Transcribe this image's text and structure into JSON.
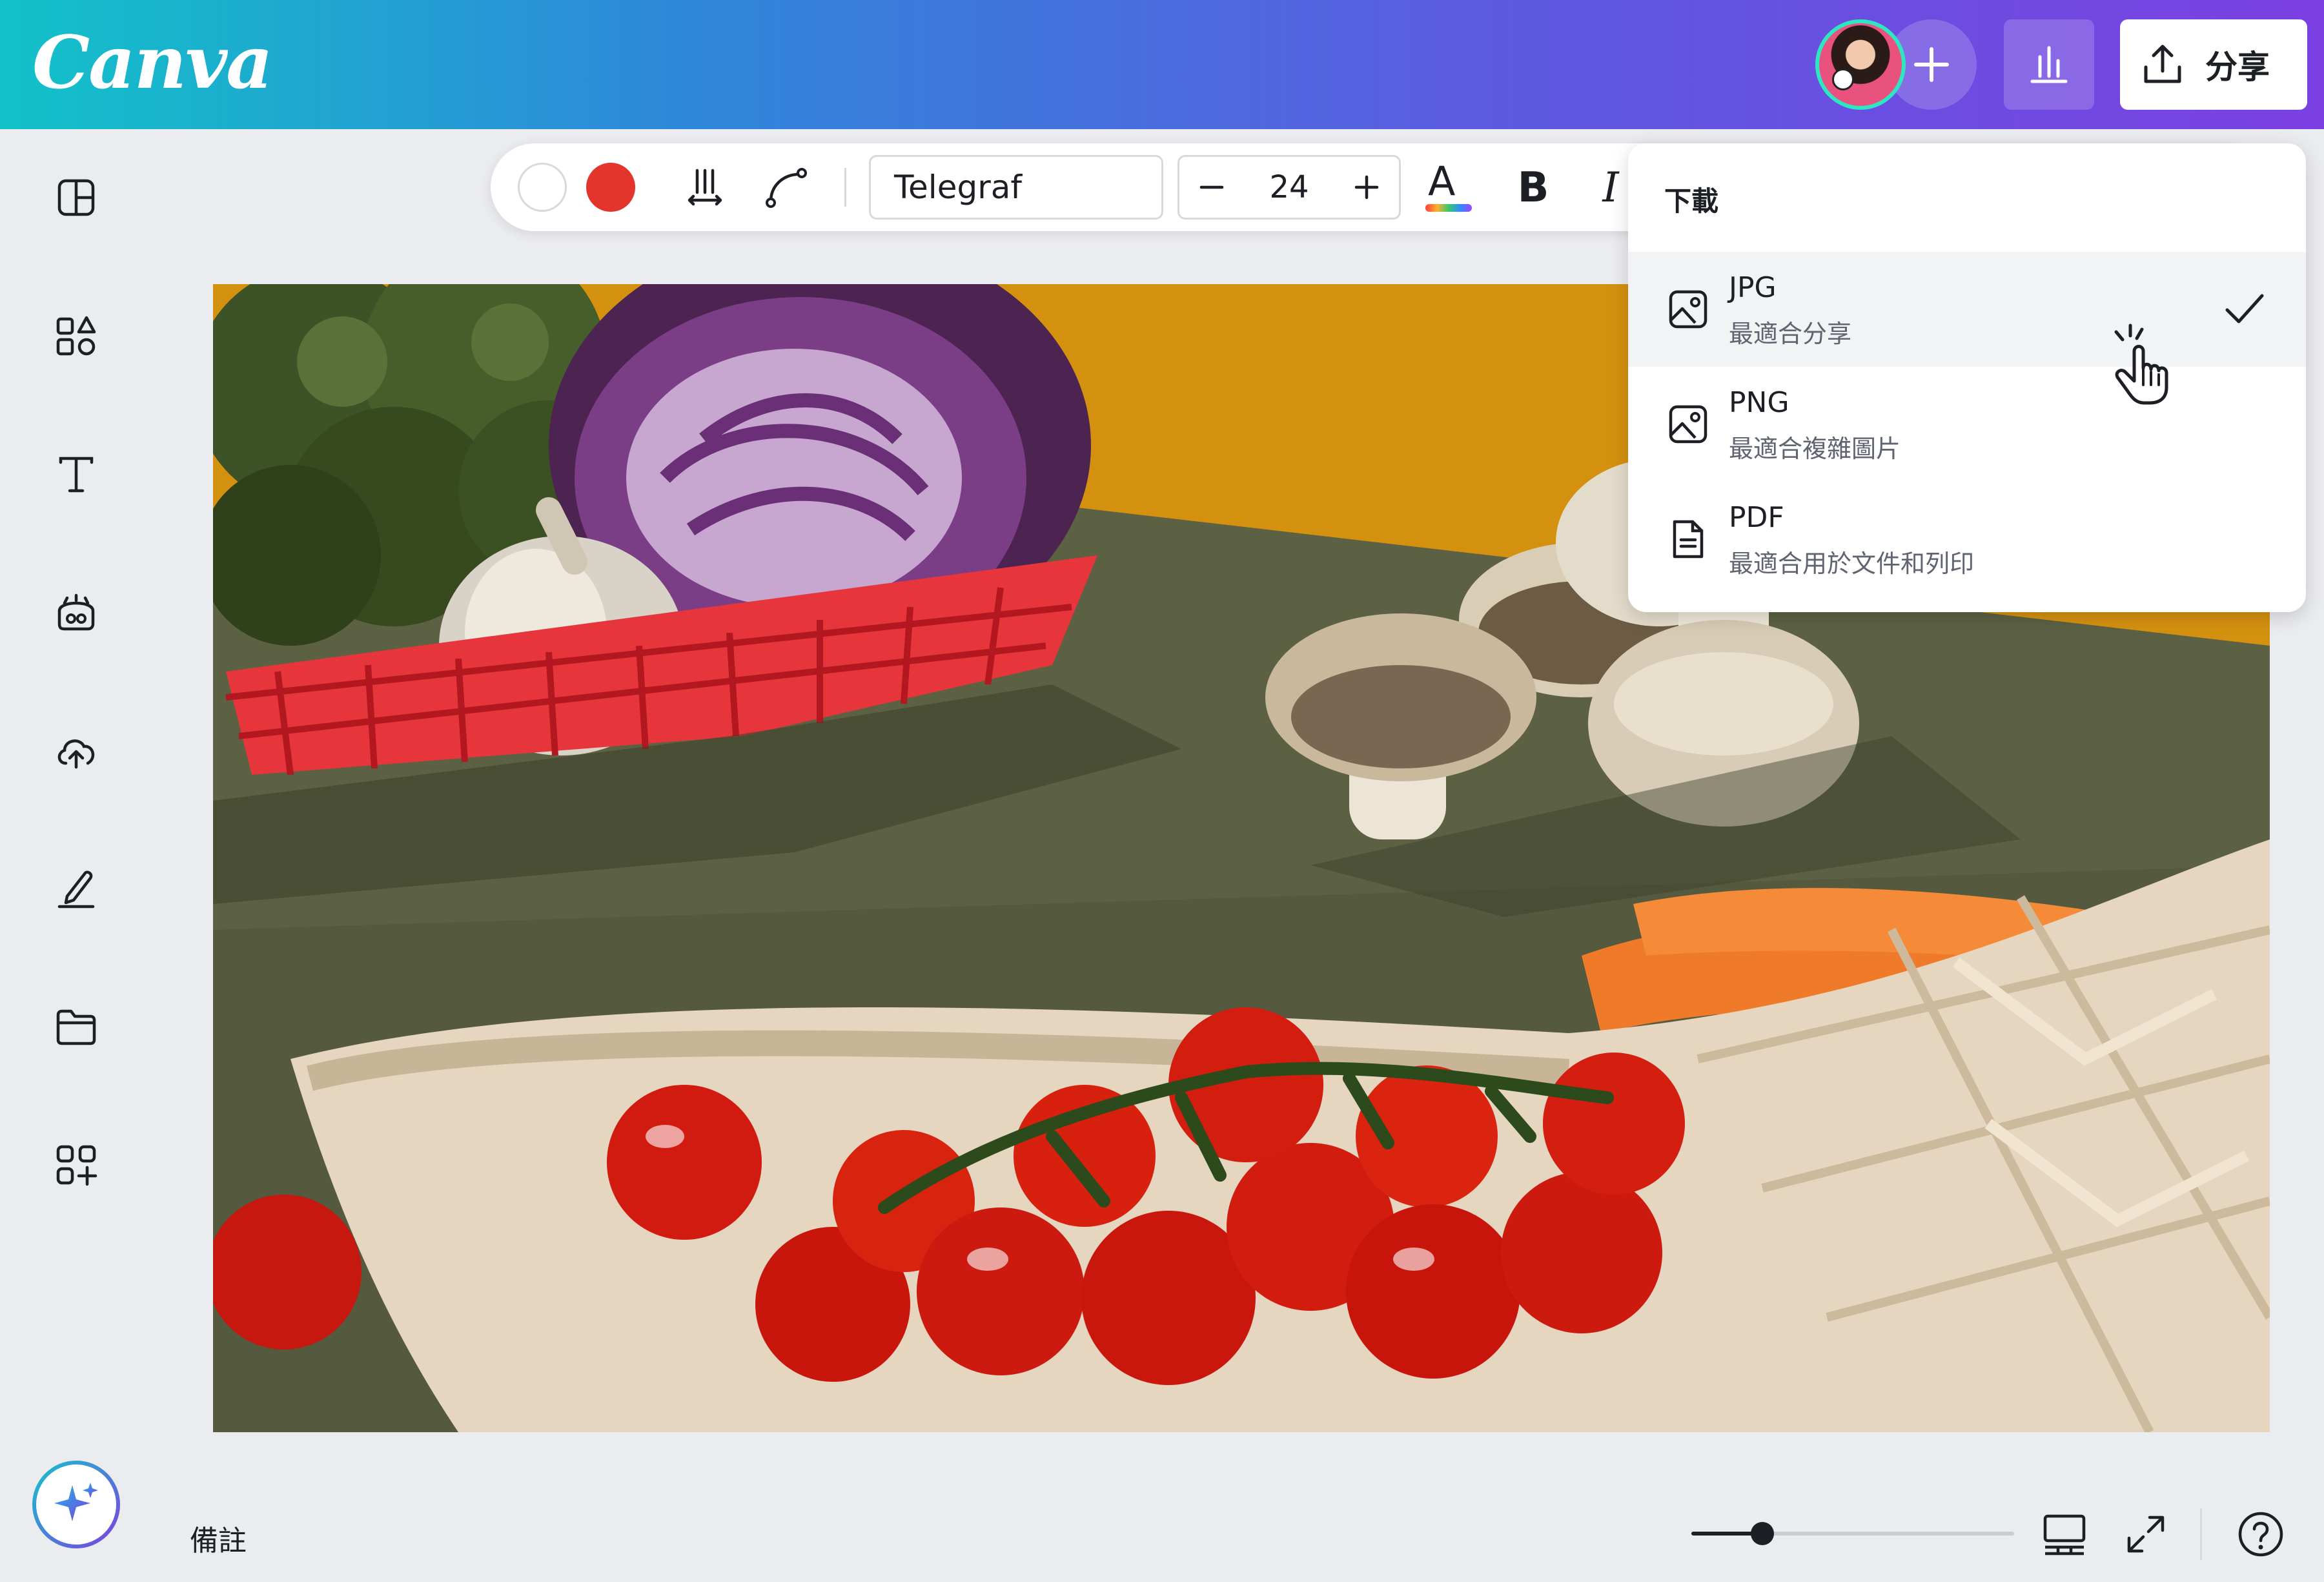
{
  "app": {
    "logo_text": "Canva"
  },
  "header": {
    "share_label": "分享",
    "icons": [
      "avatar",
      "plus-icon",
      "stats-icon",
      "share-upload-icon"
    ]
  },
  "sidebar": {
    "icons": [
      "layout-panel-icon",
      "elements-icon",
      "text-icon",
      "brand-icon",
      "upload-cloud-icon",
      "draw-icon",
      "folder-icon",
      "apps-icon"
    ],
    "magic_icon": "sparkle-icon"
  },
  "toolbar": {
    "font_name": "Telegraf",
    "font_size": "24",
    "text_color_letter": "A",
    "bold_label": "B",
    "italic_label": "I",
    "colors": {
      "empty": "#ffffff",
      "accent": "#e3352b"
    }
  },
  "download_menu": {
    "title": "下載",
    "items": [
      {
        "name": "JPG",
        "desc": "最適合分享",
        "selected": true,
        "icon": "image-icon"
      },
      {
        "name": "PNG",
        "desc": "最適合複雜圖片",
        "selected": false,
        "icon": "image-icon"
      },
      {
        "name": "PDF",
        "desc": "最適合用於文件和列印",
        "selected": false,
        "icon": "document-icon"
      }
    ]
  },
  "bottom": {
    "notes_label": "備註",
    "zoom_fraction": 0.22
  }
}
